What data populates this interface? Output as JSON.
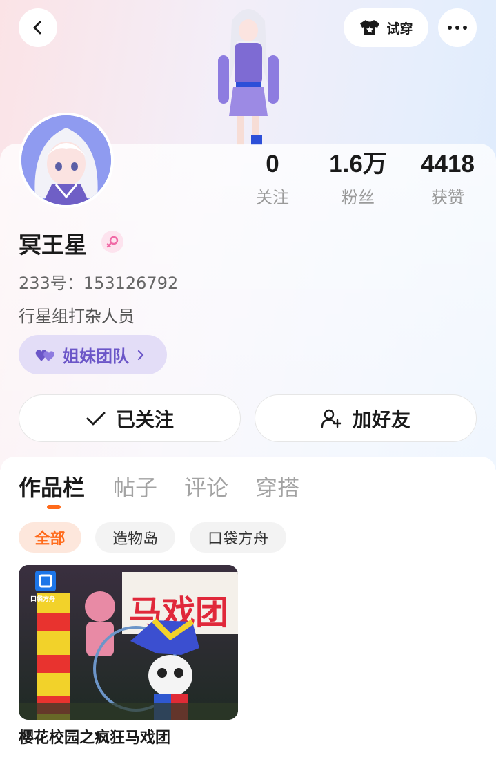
{
  "header": {
    "back_icon": "chevron-left-icon",
    "try_on_label": "试穿",
    "try_on_icon": "tshirt-icon",
    "more_icon": "more-dots-icon"
  },
  "stats": [
    {
      "value": "0",
      "label": "关注"
    },
    {
      "value": "1.6万",
      "label": "粉丝"
    },
    {
      "value": "4418",
      "label": "获赞"
    }
  ],
  "profile": {
    "name": "冥王星",
    "gender_icon": "female-icon",
    "uid": "233号：153126792",
    "bio": "行星组打杂人员",
    "team_label": "姐妹团队",
    "team_icon": "double-heart-icon"
  },
  "actions": {
    "followed_label": "已关注",
    "add_friend_label": "加好友"
  },
  "tabs": [
    {
      "label": "作品栏",
      "active": true
    },
    {
      "label": "帖子",
      "active": false
    },
    {
      "label": "评论",
      "active": false
    },
    {
      "label": "穿搭",
      "active": false
    }
  ],
  "filters": [
    {
      "label": "全部",
      "active": true
    },
    {
      "label": "造物岛",
      "active": false
    },
    {
      "label": "口袋方舟",
      "active": false
    }
  ],
  "works": [
    {
      "title": "樱花校园之疯狂马戏团",
      "cover_text": "马戏团",
      "cover_logo": "口袋方舟"
    }
  ],
  "colors": {
    "accent_orange": "#ff6a1a",
    "team_purple": "#6b56c8",
    "team_bg": "#e3ddf7"
  }
}
